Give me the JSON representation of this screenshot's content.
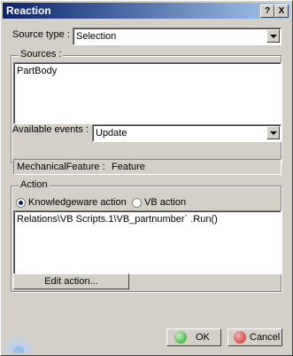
{
  "window": {
    "title": "Reaction",
    "help_btn": "?",
    "close_btn": "X"
  },
  "source_type": {
    "label": "Source type :",
    "value": "Selection"
  },
  "sources": {
    "legend": "Sources :",
    "items": [
      "PartBody"
    ]
  },
  "events": {
    "label": "Available events :",
    "value": "Update"
  },
  "status": {
    "left": "MechanicalFeature :",
    "right": "Feature"
  },
  "action": {
    "legend": "Action",
    "options": [
      "Knowledgeware action",
      "VB action"
    ],
    "selected": "Knowledgeware action",
    "text": "Relations\\VB Scripts.1\\VB_partnumber` .Run()",
    "edit_button": "Edit action..."
  },
  "footer": {
    "ok": "OK",
    "cancel": "Cancel"
  },
  "colors": {
    "title_start": "#0a246a",
    "title_end": "#a6caf0",
    "ok_green": "#2aa02a",
    "cancel_red": "#cc2222"
  }
}
